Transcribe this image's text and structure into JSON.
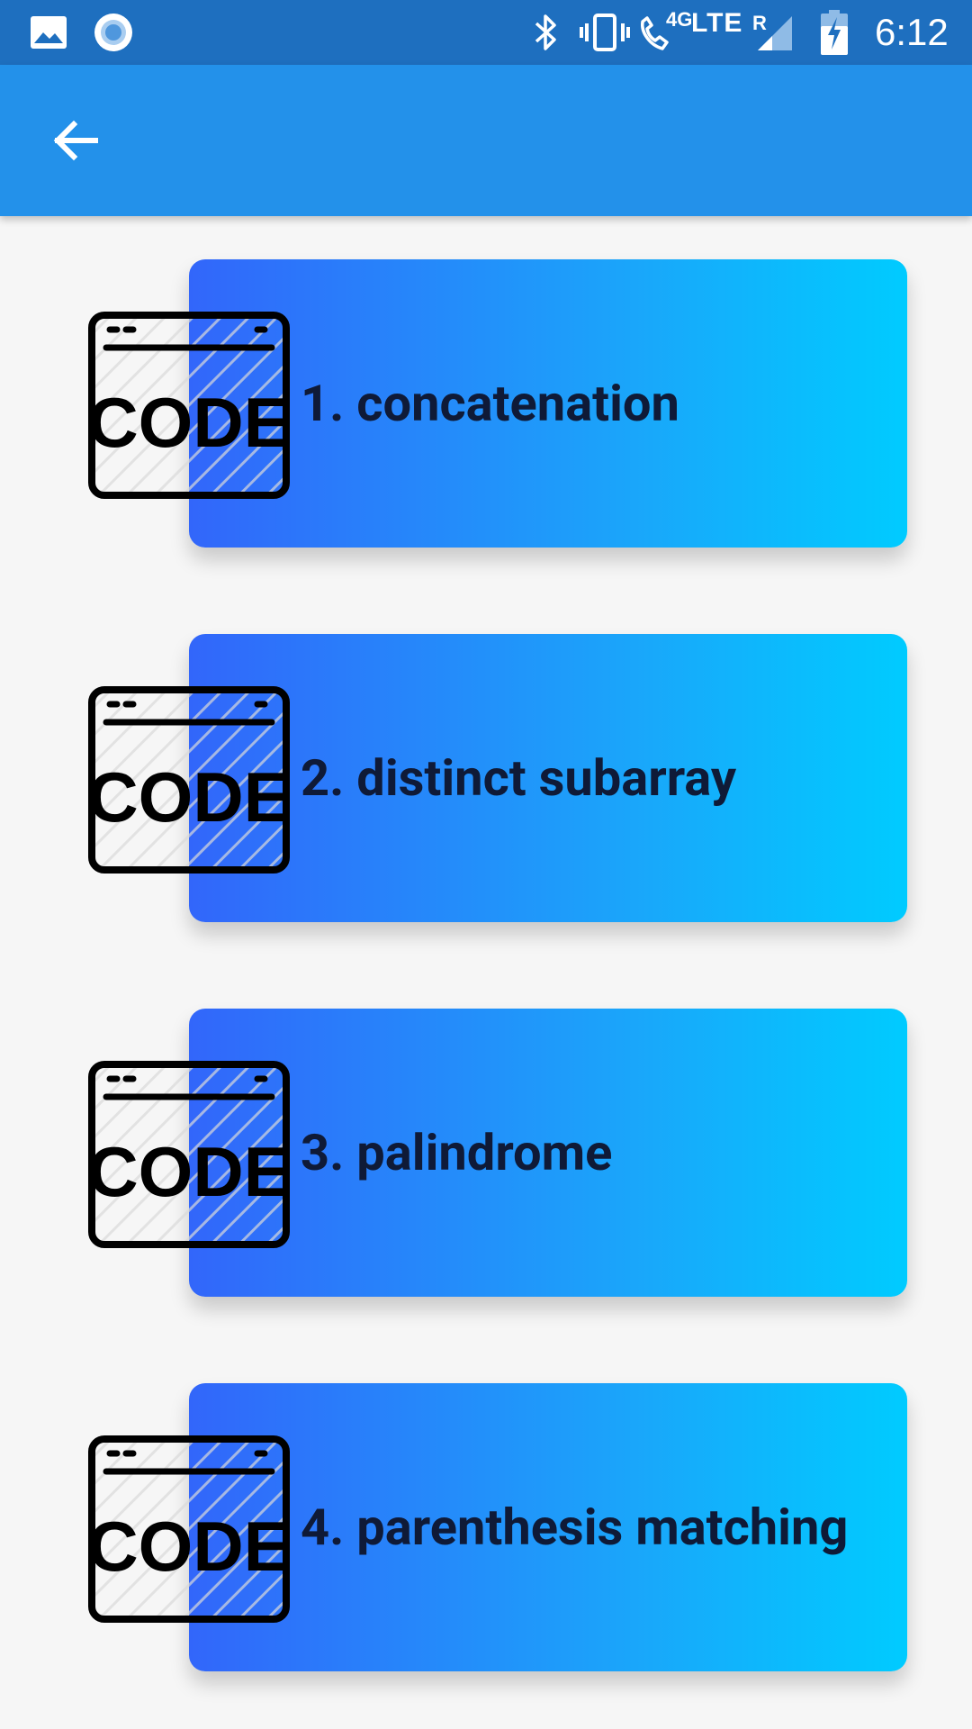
{
  "status_bar": {
    "time": "6:12",
    "network_type": "LTE",
    "call_network": "4G",
    "roaming": "R",
    "icons": [
      "image-icon",
      "record-icon",
      "bluetooth-icon",
      "vibrate-icon",
      "wifi-call-icon",
      "signal-icon",
      "battery-charging-icon"
    ]
  },
  "app_bar": {
    "back_icon": "arrow-left-icon"
  },
  "items": [
    {
      "title": "1. concatenation",
      "icon_text": "CODE"
    },
    {
      "title": "2. distinct subarray",
      "icon_text": "CODE"
    },
    {
      "title": "3. palindrome",
      "icon_text": "CODE"
    },
    {
      "title": "4. parenthesis matching",
      "icon_text": "CODE"
    }
  ],
  "colors": {
    "status_bar": "#1e6fbf",
    "app_bar": "#2391ea",
    "card_gradient_start": "#3266fa",
    "card_gradient_end": "#00cbff",
    "card_text": "#0f1a37",
    "background": "#f6f6f6"
  }
}
